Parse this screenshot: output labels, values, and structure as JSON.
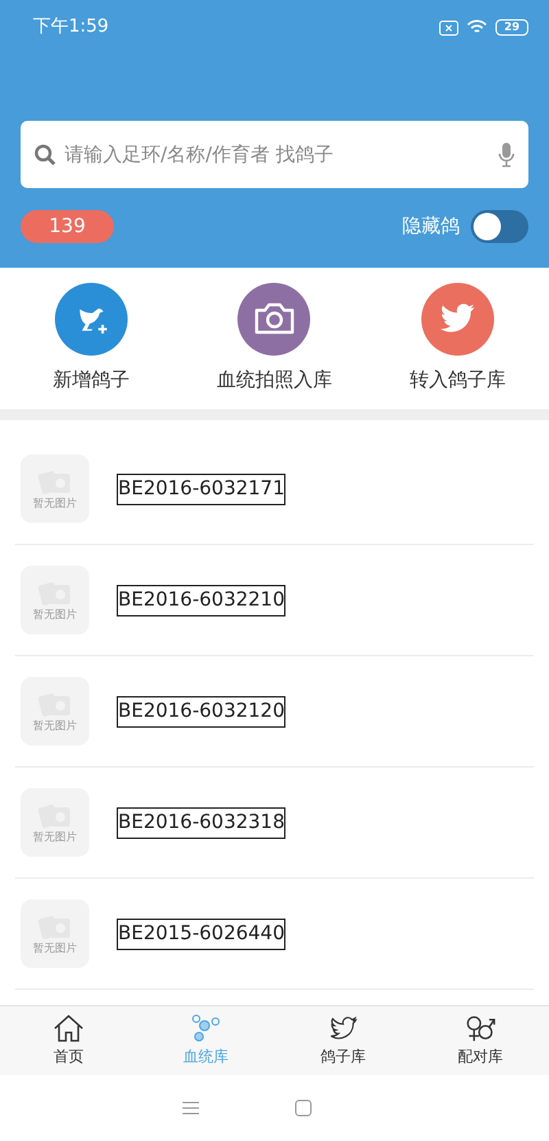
{
  "status_bar": {
    "time": "下午1:59",
    "battery": "29"
  },
  "search": {
    "placeholder": "请输入足环/名称/作育者 找鸽子"
  },
  "count_badge": "139",
  "hide_toggle": {
    "label": "隐藏鸽",
    "on": false
  },
  "actions": [
    {
      "kind": "add",
      "label": "新增鸽子",
      "color": "#2a8fd6"
    },
    {
      "kind": "camera",
      "label": "血统拍照入库",
      "color": "#8e6fa3"
    },
    {
      "kind": "bird",
      "label": "转入鸽子库",
      "color": "#eb6f5f"
    }
  ],
  "pigeons": [
    {
      "ring": "BE2016-6032171",
      "thumb": "暂无图片"
    },
    {
      "ring": "BE2016-6032210",
      "thumb": "暂无图片"
    },
    {
      "ring": "BE2016-6032120",
      "thumb": "暂无图片"
    },
    {
      "ring": "BE2016-6032318",
      "thumb": "暂无图片"
    },
    {
      "ring": "BE2015-6026440",
      "thumb": "暂无图片"
    }
  ],
  "tabs": [
    {
      "kind": "home",
      "label": "首页",
      "selected": false
    },
    {
      "kind": "pedigree",
      "label": "血统库",
      "selected": true
    },
    {
      "kind": "bird",
      "label": "鸽子库",
      "selected": false
    },
    {
      "kind": "pair",
      "label": "配对库",
      "selected": false
    }
  ]
}
